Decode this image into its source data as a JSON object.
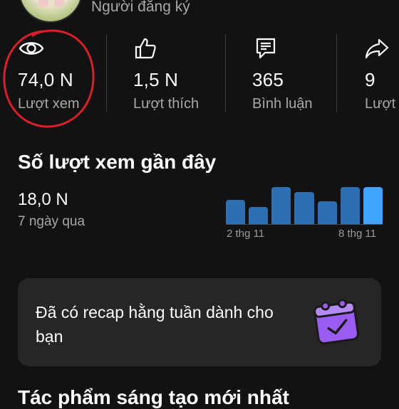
{
  "header": {
    "subscriber_label": "Người đăng ký"
  },
  "stats": [
    {
      "icon": "eye-icon",
      "value": "74,0 N",
      "label": "Lượt xem"
    },
    {
      "icon": "thumbs-up-icon",
      "value": "1,5 N",
      "label": "Lượt thích"
    },
    {
      "icon": "comment-icon",
      "value": "365",
      "label": "Bình luận"
    },
    {
      "icon": "share-icon",
      "value": "9",
      "label": "Lượt c"
    }
  ],
  "recent": {
    "title": "Số lượt xem gần đây",
    "value": "18,0 N",
    "period": "7 ngày qua"
  },
  "chart_data": {
    "type": "bar",
    "categories": [
      "2 thg 11",
      "",
      "",
      "",
      "",
      "",
      "8 thg 11"
    ],
    "values": [
      0.65,
      0.46,
      1.0,
      0.86,
      0.62,
      1.0,
      1.0
    ],
    "tick_labels": [
      "2 thg 11",
      "8 thg 11"
    ],
    "ylim": [
      0,
      1
    ],
    "bar_color": "#2d6fb3",
    "highlight_color": "#3ea6ff"
  },
  "recap": {
    "text": "Đã có recap hằng tuần dành cho bạn",
    "icon": "calendar-check-icon"
  },
  "bottom": {
    "title": "Tác phẩm sáng tạo mới nhất"
  },
  "colors": {
    "background": "#121212",
    "annotation": "#d81f2a"
  }
}
